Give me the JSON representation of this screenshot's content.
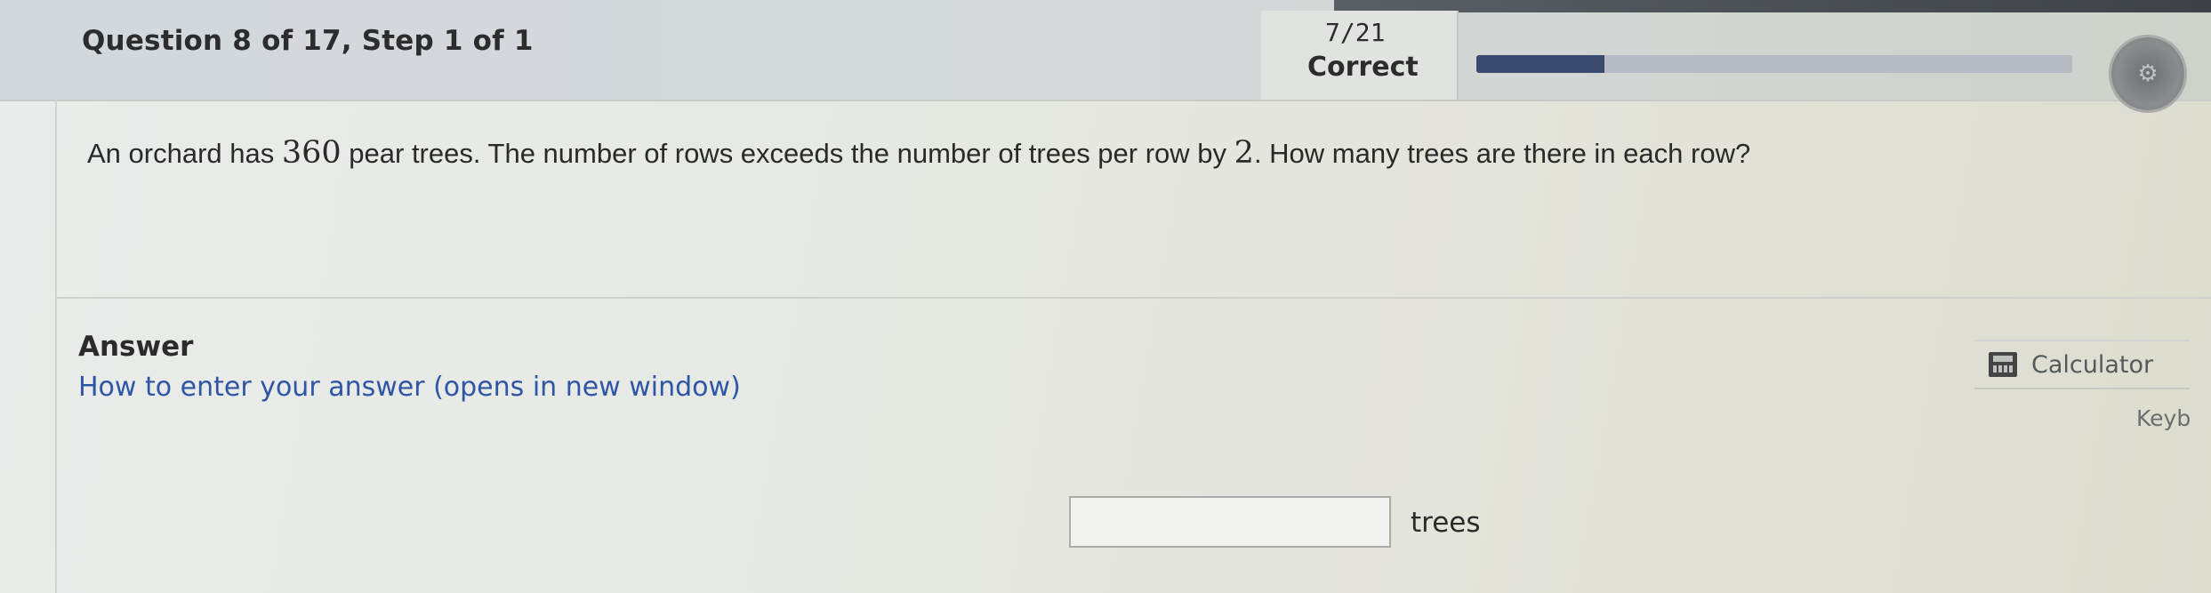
{
  "header": {
    "question_title": "Question 8 of 17,  Step 1 of 1",
    "score": "7/21",
    "status": "Correct",
    "progress_fraction": 0.215,
    "progress_color": "#3b4a6f"
  },
  "question": {
    "part1": "An orchard has ",
    "num1": "360",
    "part2": " pear trees.  The number of rows exceeds the number of trees per row by ",
    "num2": "2",
    "part3": ".  How many trees are there in each row?"
  },
  "answer": {
    "label": "Answer",
    "howto_link": "How to enter your answer (opens in new window)",
    "input_value": "",
    "unit": "trees"
  },
  "tools": {
    "calculator_label": "Calculator",
    "calculator_icon": "calculator-icon",
    "keyboard_label": "Keyb"
  },
  "colors": {
    "link": "#2f56a6",
    "progress_track": "#b7bcc4"
  }
}
